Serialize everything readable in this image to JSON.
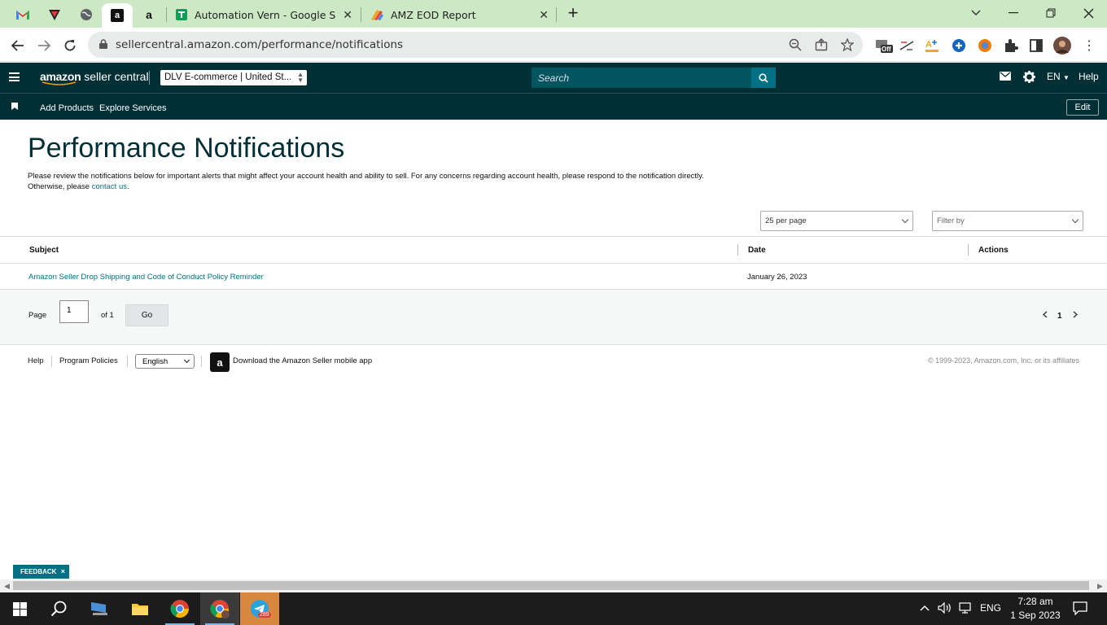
{
  "browser": {
    "tabs": [
      {
        "title": "Automation Vern - Google Sheets"
      },
      {
        "title": "AMZ EOD Report"
      }
    ],
    "url": "sellercentral.amazon.com/performance/notifications",
    "ext_off_badge": "Off"
  },
  "header": {
    "logo_brand": "amazon",
    "logo_suffix": " seller central",
    "account": "DLV E-commerce | United St...",
    "search_placeholder": "Search",
    "language": "EN",
    "help": "Help"
  },
  "subnav": {
    "items": [
      "Add Products",
      "Explore Services"
    ],
    "edit": "Edit"
  },
  "page": {
    "title": "Performance Notifications",
    "description": "Please review the notifications below for important alerts that might affect your account health and ability to sell. For any concerns regarding account health, please respond to the notification directly.",
    "description_line2": "Otherwise, please ",
    "contact_link": "contact us",
    "contact_suffix": "."
  },
  "controls": {
    "per_page": "25 per page",
    "filter": "Filter by"
  },
  "table": {
    "headers": {
      "subject": "Subject",
      "date": "Date",
      "actions": "Actions"
    },
    "rows": [
      {
        "subject": "Amazon Seller Drop Shipping and Code of Conduct Policy Reminder",
        "date": "January 26, 2023"
      }
    ]
  },
  "pager": {
    "page_label": "Page",
    "page_value": "1",
    "of_label": "of 1",
    "go": "Go",
    "current": "1"
  },
  "footer": {
    "help": "Help",
    "policies": "Program Policies",
    "language": "English",
    "app_text": "Download the Amazon Seller mobile app",
    "copyright": "© 1999-2023, Amazon.com, Inc. or its affiliates"
  },
  "feedback": "FEEDBACK",
  "taskbar": {
    "telegram_badge": "289",
    "lang": "ENG",
    "time": "7:28 am",
    "date": "1 Sep 2023"
  }
}
